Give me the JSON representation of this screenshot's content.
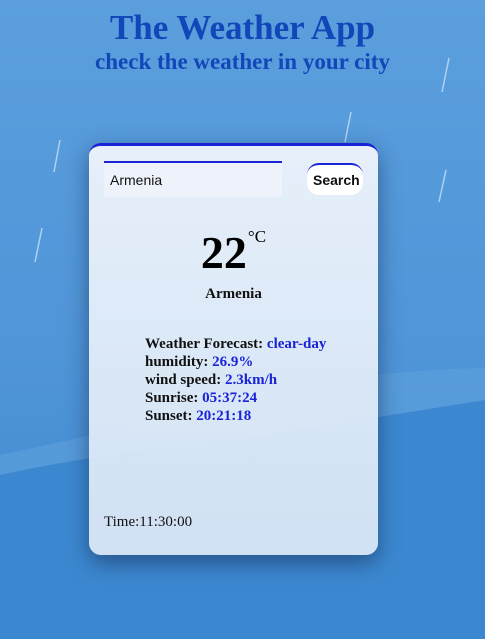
{
  "header": {
    "title": "The Weather App",
    "subtitle": "check the weather in your city"
  },
  "search": {
    "value": "Armenia",
    "button_label": "Search"
  },
  "weather": {
    "temperature": "22",
    "unit": "°C",
    "city": "Armenia",
    "forecast_label": "Weather Forecast:",
    "forecast_value": "clear-day",
    "humidity_label": "humidity:",
    "humidity_value": "26.9%",
    "wind_label": "wind speed:",
    "wind_value": "2.3km/h",
    "sunrise_label": "Sunrise:",
    "sunrise_value": "05:37:24",
    "sunset_label": "Sunset:",
    "sunset_value": "20:21:18"
  },
  "clock": {
    "text": "Time:11:30:00"
  },
  "colors": {
    "accent": "#1a23d6",
    "title": "#1147b8",
    "background": "#5b9fdd"
  }
}
